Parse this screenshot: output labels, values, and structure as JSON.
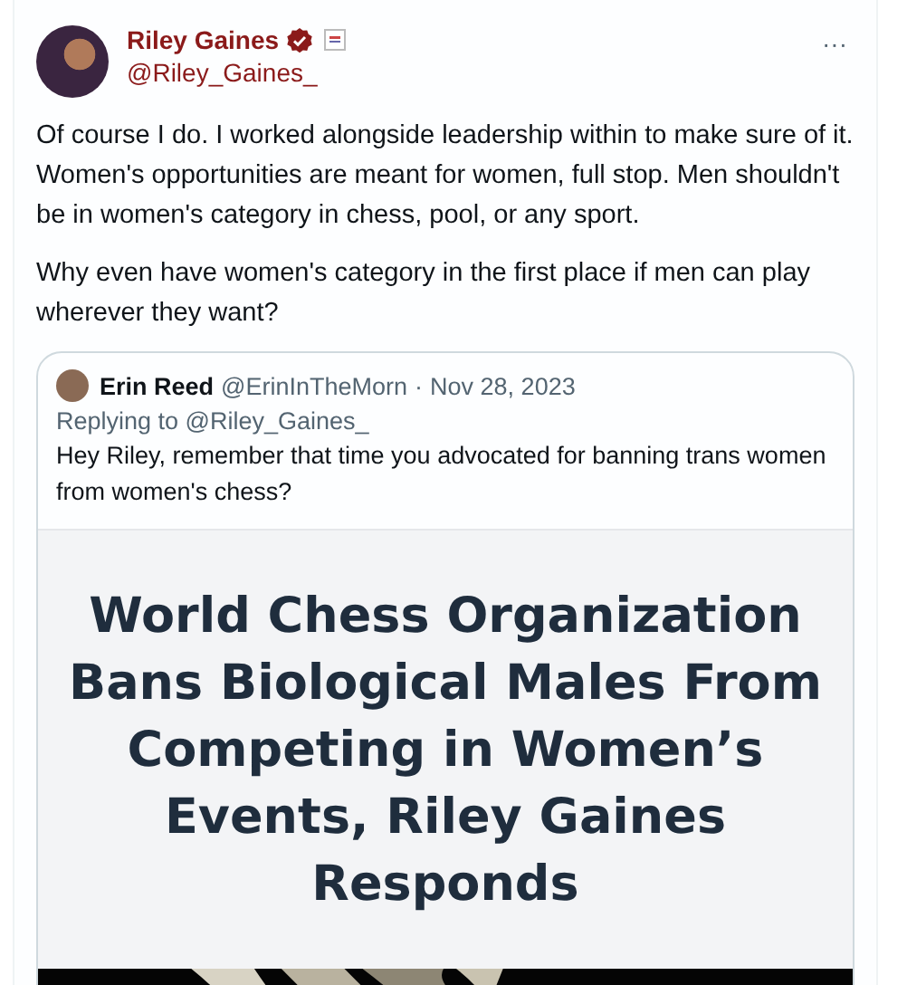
{
  "post": {
    "author": {
      "name": "Riley Gaines",
      "handle": "@Riley_Gaines_",
      "verified": true
    },
    "more": "···",
    "paragraphs": [
      "Of course I do. I worked alongside leadership within to make sure of it. Women's opportunities are meant for women, full stop. Men shouldn't be in women's category in chess, pool, or any sport.",
      "Why even have women's category in the first place if men can play wherever they want?"
    ],
    "quote": {
      "name": "Erin Reed",
      "handle": "@ErinInTheMorn",
      "separator": "·",
      "date": "Nov 28, 2023",
      "replying_to": "Replying to @Riley_Gaines_",
      "text": "Hey Riley, remember that time you advocated for banning trans women from women's chess?",
      "media": {
        "headline": "World Chess Organization Bans Biological Males From Competing in Women’s Events, Riley Gaines Responds"
      }
    }
  }
}
